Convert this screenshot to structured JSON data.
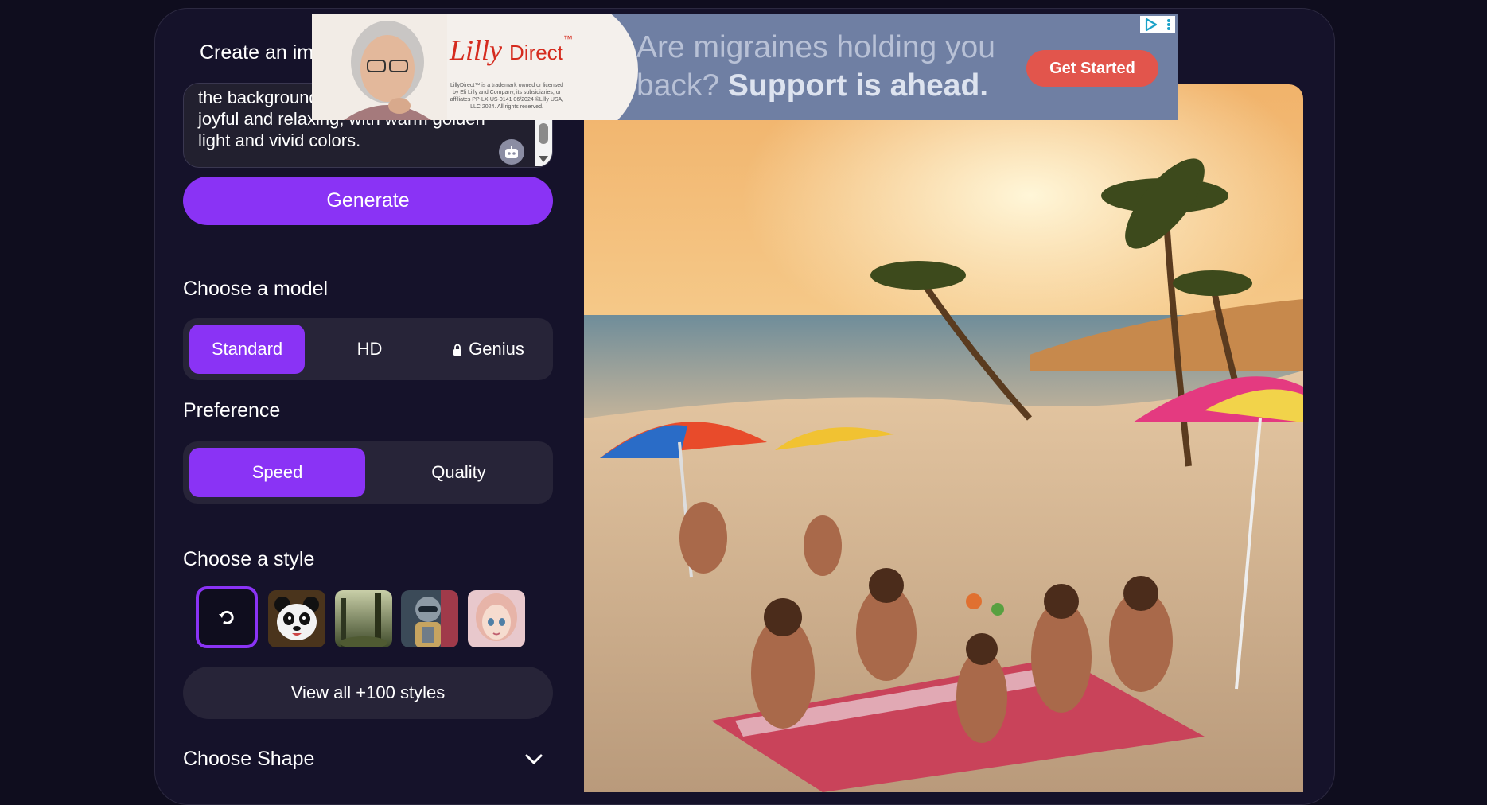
{
  "prompt": {
    "heading": "Create an image",
    "text": "the background, making the scene feel joyful and relaxing, with warm golden light and vivid colors."
  },
  "generate_label": "Generate",
  "model": {
    "heading": "Choose a model",
    "options": [
      "Standard",
      "HD",
      "Genius"
    ],
    "selected": "Standard"
  },
  "preference": {
    "heading": "Preference",
    "options": [
      "Speed",
      "Quality"
    ],
    "selected": "Speed"
  },
  "style": {
    "heading": "Choose a style",
    "thumbnails": [
      "none",
      "panda",
      "forest",
      "robot",
      "anime-girl"
    ],
    "view_all_label": "View all +100 styles"
  },
  "shape": {
    "heading": "Choose Shape"
  },
  "ad": {
    "brand_script": "Lilly",
    "brand_word": "Direct",
    "brand_tm": "™",
    "fine_print": "LillyDirect™ is a trademark owned or licensed by Eli Lilly and Company, its subsidiaries, or affiliates PP-LX-US-0141 06/2024 ©Lilly USA, LLC 2024. All rights reserved.",
    "headline_normal": "Are migraines holding you back?",
    "headline_bold": "Support is ahead.",
    "cta": "Get Started"
  },
  "colors": {
    "accent": "#8a33f5",
    "background": "#0f0d1e",
    "panel": "#15122a",
    "control": "#272438",
    "ad_cta": "#e2554c"
  }
}
